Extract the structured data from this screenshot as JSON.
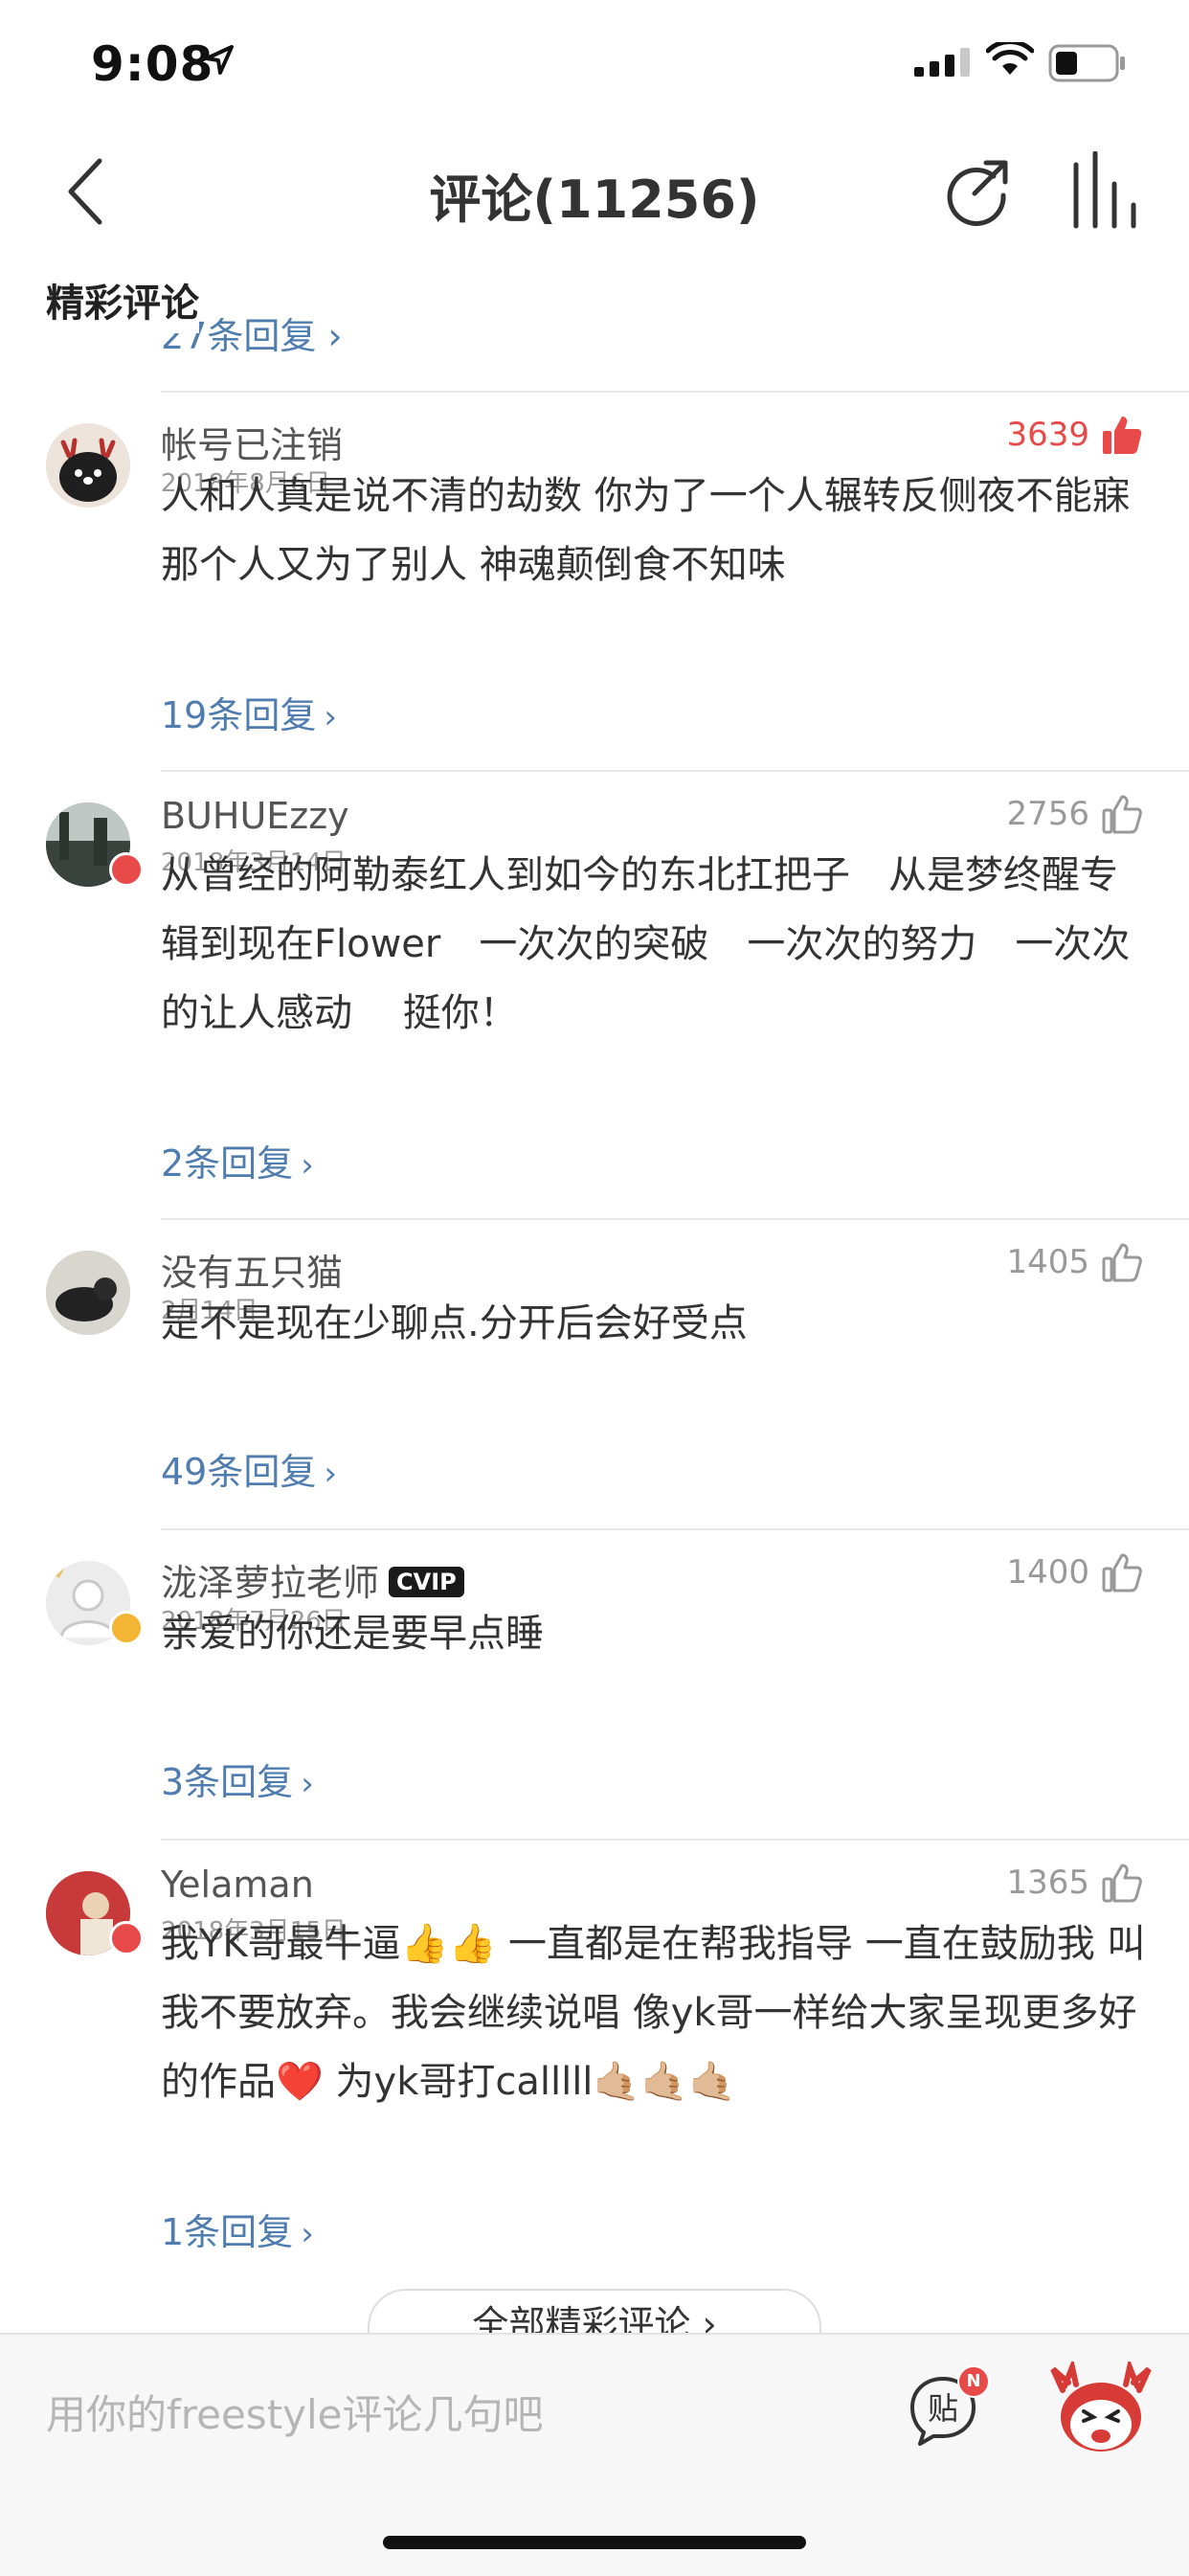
{
  "status_bar": {
    "time": "9:08"
  },
  "nav": {
    "title": "评论(11256)"
  },
  "section": {
    "title": "精彩评论",
    "partial_reply": "27条回复 ›"
  },
  "comments": [
    {
      "username": "帐号已注销",
      "date": "2018年8月6日",
      "likes": "3639",
      "liked": true,
      "text": "人和人真是说不清的劫数 你为了一个人辗转反侧夜不能寐 那个人又为了别人 神魂颠倒食不知味",
      "replies": "19条回复"
    },
    {
      "username": "BUHUEzzy",
      "date": "2018年3月14日",
      "likes": "2756",
      "liked": false,
      "text": "从曾经的阿勒泰红人到如今的东北扛把子　从是梦终醒专辑到现在Flower　一次次的突破　一次次的努力　一次次的让人感动　 挺你！",
      "replies": "2条回复"
    },
    {
      "username": "没有五只猫",
      "date": "2月14日",
      "likes": "1405",
      "liked": false,
      "text": "是不是现在少聊点.分开后会好受点",
      "replies": "49条回复"
    },
    {
      "username": "泷泽萝拉老师",
      "vip": "CVIP",
      "date": "2018年7月26日",
      "likes": "1400",
      "liked": false,
      "text": "亲爱的你还是要早点睡",
      "replies": "3条回复"
    },
    {
      "username": "Yelaman",
      "date": "2018年3月15日",
      "likes": "1365",
      "liked": false,
      "text": "我YK哥最牛逼👍👍 一直都是在帮我指导 一直在鼓励我 叫我不要放弃。我会继续说唱 像yk哥一样给大家呈现更多好的作品❤️ 为yk哥打calllll🤙🏼🤙🏼🤙🏼",
      "replies": "1条回复"
    }
  ],
  "all_button": "全部精彩评论 ›",
  "input": {
    "placeholder": "用你的freestyle评论几句吧"
  },
  "tie_badge": "N",
  "tie_label": "贴",
  "colors": {
    "accent_red": "#e84a4a",
    "link_blue": "#507daf"
  }
}
